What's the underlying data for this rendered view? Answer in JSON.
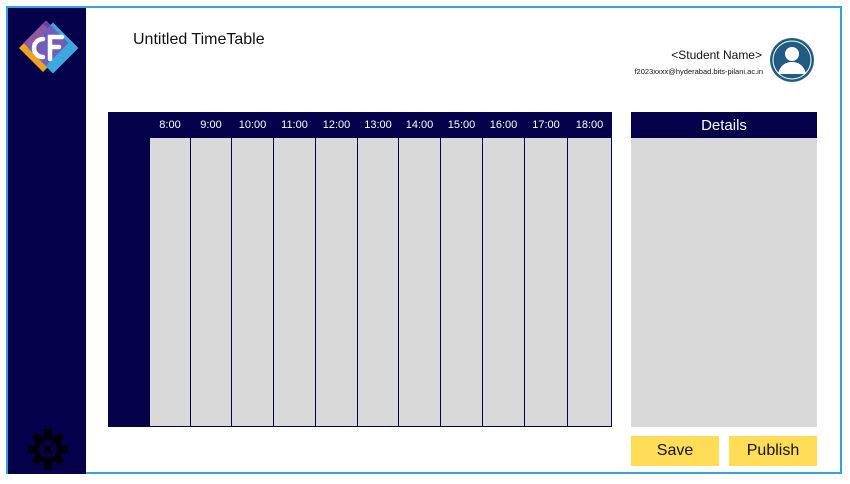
{
  "app": {
    "title": "Untitled TimeTable",
    "logo_icon": "cf-logo-icon",
    "settings_icon": "gear-icon"
  },
  "user": {
    "name": "<Student Name>",
    "email": "f2023xxxx@hyderabad.bits-pilani.ac.in",
    "avatar_icon": "user-avatar-icon"
  },
  "timetable": {
    "times": [
      "8:00",
      "9:00",
      "10:00",
      "11:00",
      "12:00",
      "13:00",
      "14:00",
      "15:00",
      "16:00",
      "17:00",
      "18:00"
    ]
  },
  "details": {
    "title": "Details"
  },
  "actions": {
    "save_label": "Save",
    "publish_label": "Publish"
  },
  "colors": {
    "navy": "#05004a",
    "accent_blue": "#3aa0e6",
    "button_yellow": "#ffdd57",
    "slot_gray": "#d9d9d9",
    "avatar_blue": "#1f5b82"
  }
}
